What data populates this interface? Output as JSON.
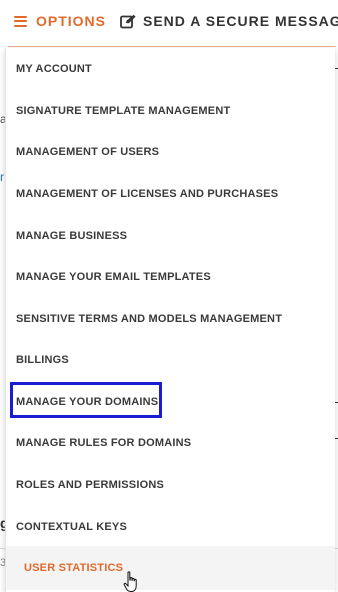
{
  "topbar": {
    "options_label": "OPTIONS",
    "secure_message_label": "SEND A SECURE MESSAGE",
    "accent_color": "#e06a2c"
  },
  "menu": {
    "items": [
      {
        "label": "MY ACCOUNT"
      },
      {
        "label": "SIGNATURE TEMPLATE MANAGEMENT"
      },
      {
        "label": "MANAGEMENT OF USERS"
      },
      {
        "label": "MANAGEMENT OF LICENSES AND PURCHASES"
      },
      {
        "label": "MANAGE BUSINESS"
      },
      {
        "label": "MANAGE YOUR EMAIL TEMPLATES"
      },
      {
        "label": "SENSITIVE TERMS AND MODELS MANAGEMENT"
      },
      {
        "label": "BILLINGS"
      },
      {
        "label": "MANAGE YOUR DOMAINS",
        "highlighted": true
      },
      {
        "label": "MANAGE RULES FOR DOMAINS"
      },
      {
        "label": "ROLES AND PERMISSIONS"
      },
      {
        "label": "CONTEXTUAL KEYS"
      },
      {
        "label": "USER STATISTICS",
        "active": true
      }
    ],
    "highlight_color": "#1b1bd0"
  },
  "background": {
    "frag_a": "a",
    "frag_r": "r",
    "frag_g": "g",
    "frag_3": "3"
  }
}
